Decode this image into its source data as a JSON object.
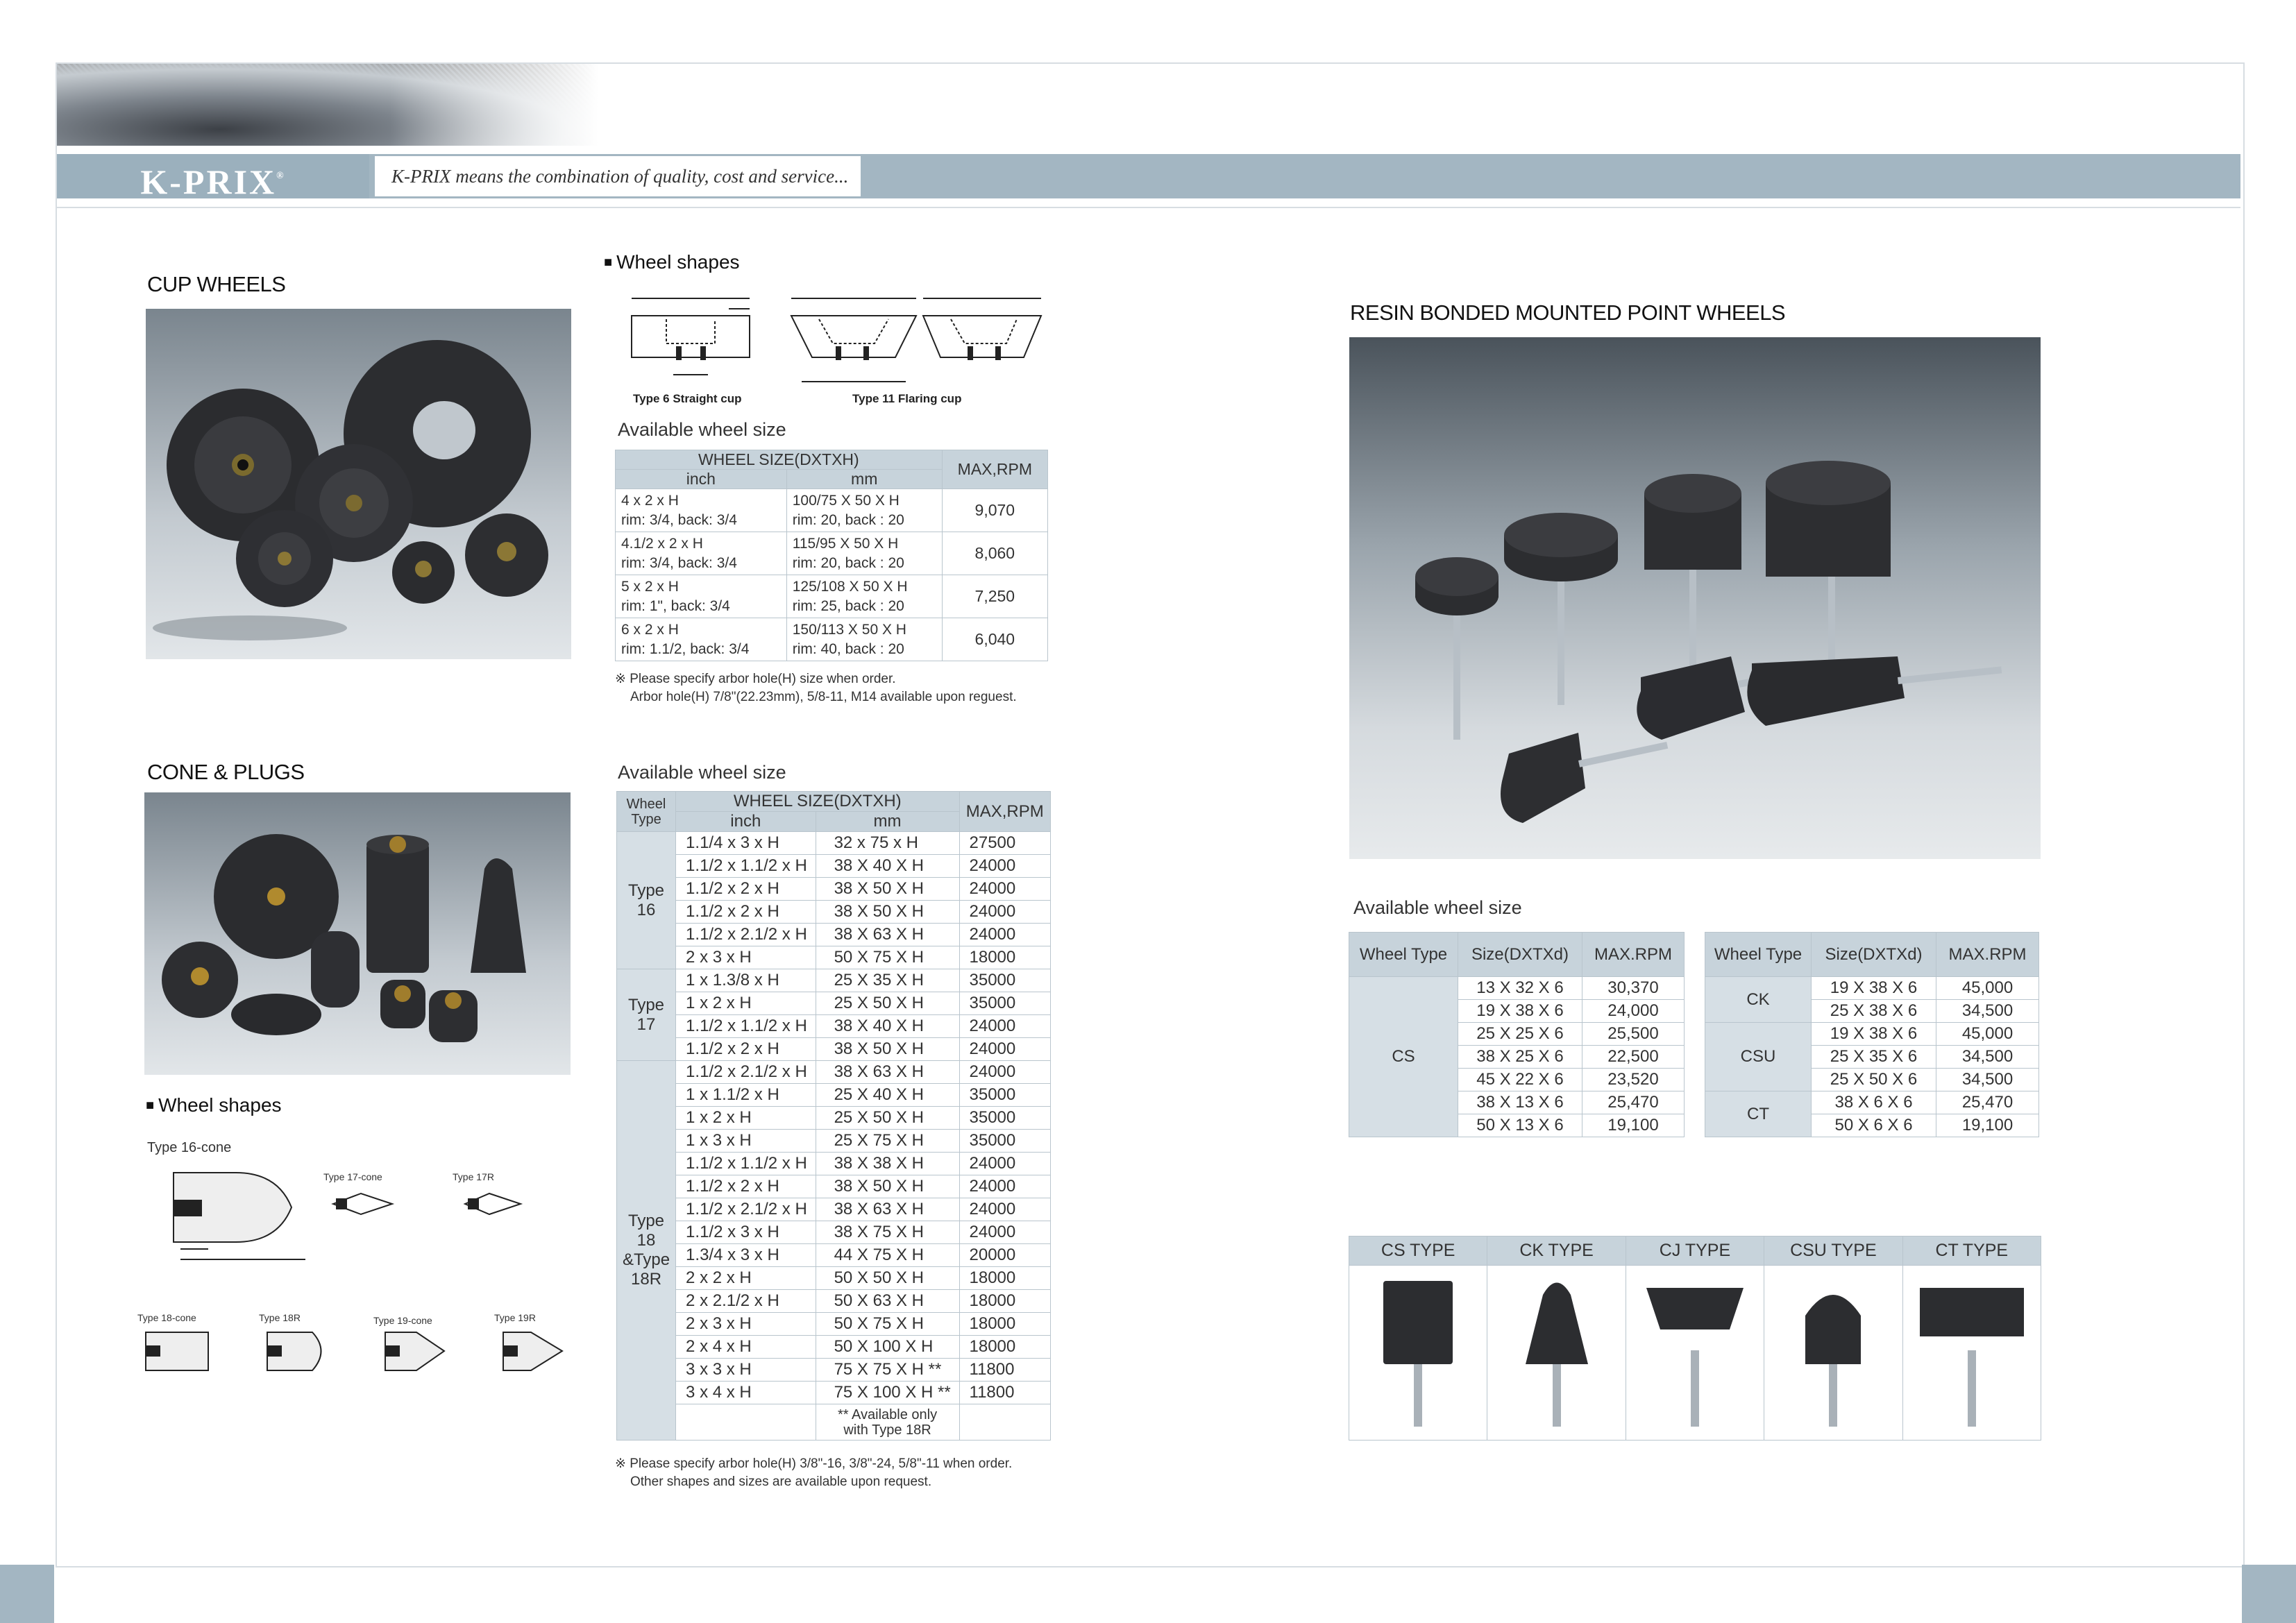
{
  "header": {
    "brand": "K-PRIX",
    "reg_mark": "®",
    "tagline": "K-PRIX means the combination of quality, cost and service..."
  },
  "cup_wheels": {
    "title": "CUP WHEELS",
    "shapes_title": "Wheel shapes",
    "shape_captions": [
      "Type 6 Straight cup",
      "Type 11 Flaring cup"
    ],
    "table_caption": "Available wheel size",
    "table": {
      "header_group": "WHEEL SIZE(DXTXH)",
      "col_inch": "inch",
      "col_mm": "mm",
      "col_rpm": "MAX,RPM",
      "rows": [
        {
          "inch1": "4 x 2 x H",
          "inch2": "rim: 3/4, back: 3/4",
          "mm1": "100/75 X 50 X H",
          "mm2": "rim: 20, back : 20",
          "rpm": "9,070"
        },
        {
          "inch1": "4.1/2 x 2 x H",
          "inch2": "rim: 3/4, back: 3/4",
          "mm1": "115/95 X 50 X H",
          "mm2": "rim: 20, back : 20",
          "rpm": "8,060"
        },
        {
          "inch1": "5 x 2 x H",
          "inch2": "rim: 1\", back: 3/4",
          "mm1": "125/108 X 50 X H",
          "mm2": "rim: 25, back : 20",
          "rpm": "7,250"
        },
        {
          "inch1": "6 x 2 x H",
          "inch2": "rim: 1.1/2, back: 3/4",
          "mm1": "150/113 X 50 X H",
          "mm2": "rim: 40, back : 20",
          "rpm": "6,040"
        }
      ]
    },
    "note1": "※ Please specify arbor hole(H) size when order.",
    "note2": "Arbor hole(H) 7/8\"(22.23mm), 5/8-11, M14 available upon reguest."
  },
  "cone_plugs": {
    "title": "CONE & PLUGS",
    "shapes_title": "Wheel shapes",
    "shape_labels": [
      "Type 16-cone",
      "Type 17-cone",
      "Type 17R",
      "Type 18-cone",
      "Type 18R",
      "Type 19-cone",
      "Type 19R"
    ],
    "table_caption": "Available wheel size",
    "table": {
      "col_type": "Wheel Type",
      "header_group": "WHEEL SIZE(DXTXH)",
      "col_inch": "inch",
      "col_mm": "mm",
      "col_rpm": "MAX,RPM",
      "groups": [
        {
          "type": "Type 16",
          "rows": [
            [
              "1.1/4 x 3 x H",
              "32 x 75 x H",
              "27500"
            ],
            [
              "1.1/2 x 1.1/2 x H",
              "38 X 40 X H",
              "24000"
            ],
            [
              "1.1/2 x 2 x H",
              "38 X 50 X H",
              "24000"
            ],
            [
              "1.1/2 x 2 x H",
              "38 X 50 X H",
              "24000"
            ],
            [
              "1.1/2 x 2.1/2 x H",
              "38 X 63 X H",
              "24000"
            ],
            [
              "2 x 3 x H",
              "50 X 75 X H",
              "18000"
            ]
          ]
        },
        {
          "type": "Type 17",
          "rows": [
            [
              "1 x 1.3/8 x H",
              "25 X 35 X H",
              "35000"
            ],
            [
              "1 x 2 x H",
              "25 X 50 X H",
              "35000"
            ],
            [
              "1.1/2 x 1.1/2 x H",
              "38 X 40 X H",
              "24000"
            ],
            [
              "1.1/2 x 2 x H",
              "38 X 50 X H",
              "24000"
            ]
          ]
        },
        {
          "type": "Type 18 &Type 18R",
          "rows": [
            [
              "1.1/2 x 2.1/2 x H",
              "38 X 63 X H",
              "24000"
            ],
            [
              "1 x 1.1/2 x H",
              "25 X 40 X H",
              "35000"
            ],
            [
              "1 x 2 x H",
              "25 X 50 X H",
              "35000"
            ],
            [
              "1 x 3 x H",
              "25 X 75 X H",
              "35000"
            ],
            [
              "1.1/2 x 1.1/2 x H",
              "38 X 38 X H",
              "24000"
            ],
            [
              "1.1/2 x 2 x H",
              "38 X 50 X H",
              "24000"
            ],
            [
              "1.1/2 x 2.1/2 x H",
              "38 X 63 X H",
              "24000"
            ],
            [
              "1.1/2 x 3 x H",
              "38 X 75 X H",
              "24000"
            ],
            [
              "1.3/4 x 3 x H",
              "44 X 75 X H",
              "20000"
            ],
            [
              "2 x 2 x H",
              "50 X 50 X H",
              "18000"
            ],
            [
              "2 x 2.1/2 x H",
              "50 X 63 X H",
              "18000"
            ],
            [
              "2 x 3 x H",
              "50 X 75 X H",
              "18000"
            ],
            [
              "2 x 4 x H",
              "50 X 100 X H",
              "18000"
            ],
            [
              "3 x 3 x H",
              "75 X 75 X H **",
              "11800"
            ],
            [
              "3 x 4 x H",
              "75 X 100 X H **",
              "11800"
            ]
          ]
        }
      ],
      "footnote1": "** Available only",
      "footnote2": "with Type 18R"
    },
    "note1": "※ Please specify arbor hole(H) 3/8\"-16, 3/8\"-24, 5/8\"-11 when order.",
    "note2": "Other shapes and sizes are available upon request."
  },
  "mounted": {
    "title": "RESIN BONDED MOUNTED POINT WHEELS",
    "table_caption": "Available wheel size",
    "table_a": {
      "col_type": "Wheel Type",
      "col_size": "Size(DXTXd)",
      "col_rpm": "MAX.RPM",
      "type": "CS",
      "rows": [
        [
          "13 X 32 X 6",
          "30,370"
        ],
        [
          "19 X 38 X 6",
          "24,000"
        ],
        [
          "25 X 25 X 6",
          "25,500"
        ],
        [
          "38 X 25 X 6",
          "22,500"
        ],
        [
          "45 X 22 X 6",
          "23,520"
        ],
        [
          "38 X 13 X 6",
          "25,470"
        ],
        [
          "50 X 13 X 6",
          "19,100"
        ]
      ]
    },
    "table_b": {
      "col_type": "Wheel Type",
      "col_size": "Size(DXTXd)",
      "col_rpm": "MAX.RPM",
      "groups": [
        {
          "type": "CK",
          "rows": [
            [
              "19 X 38 X 6",
              "45,000"
            ],
            [
              "25 X 38 X 6",
              "34,500"
            ]
          ]
        },
        {
          "type": "CSU",
          "rows": [
            [
              "19 X 38 X 6",
              "45,000"
            ],
            [
              "25 X 35 X 6",
              "34,500"
            ],
            [
              "25 X 50 X 6",
              "34,500"
            ]
          ]
        },
        {
          "type": "CT",
          "rows": [
            [
              "38 X 6 X 6",
              "25,470"
            ],
            [
              "50 X 6 X 6",
              "19,100"
            ]
          ]
        }
      ]
    },
    "types": [
      "CS TYPE",
      "CK TYPE",
      "CJ TYPE",
      "CSU TYPE",
      "CT TYPE"
    ]
  }
}
